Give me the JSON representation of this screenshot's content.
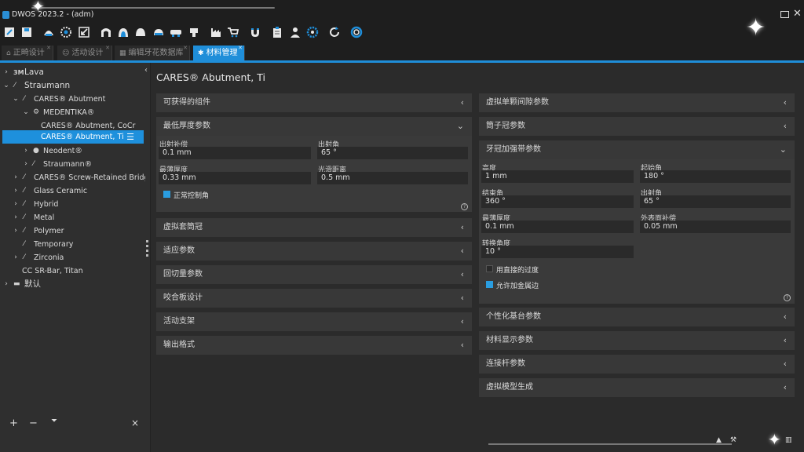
{
  "window": {
    "title": "DWOS 2023.2 - (adm)"
  },
  "toolbar": {
    "icons": [
      "edit-icon",
      "save-icon",
      "scan-icon",
      "gear-sphere-icon",
      "import-icon",
      "arch-upper-icon",
      "arch-lower-icon",
      "dome-icon",
      "crown-icon",
      "bridge-icon",
      "tooth-icon",
      "factory-icon",
      "cart-icon",
      "magnet-icon",
      "clipboard-icon",
      "person-icon",
      "settings-icon",
      "refresh-icon",
      "lifebuoy-icon"
    ]
  },
  "tabs": [
    {
      "label": "正畸设计",
      "active": false
    },
    {
      "label": "活动设计",
      "active": false
    },
    {
      "label": "编辑牙花数据库",
      "active": false
    },
    {
      "label": "材料管理",
      "active": true
    }
  ],
  "tree": [
    {
      "label": "Lava",
      "level": 0,
      "expanded": false,
      "icon": "3m-icon"
    },
    {
      "label": "Straumann",
      "level": 0,
      "expanded": true,
      "icon": "brand-icon"
    },
    {
      "label": "CARES® Abutment",
      "level": 1,
      "expanded": true,
      "icon": "brand-icon"
    },
    {
      "label": "MEDENTIKA®",
      "level": 2,
      "expanded": true,
      "icon": "gear-icon"
    },
    {
      "label": "CARES® Abutment, CoCr",
      "level": 3
    },
    {
      "label": "CARES® Abutment, Ti",
      "level": 3,
      "selected": true
    },
    {
      "label": "Neodent®",
      "level": 2,
      "expanded": false,
      "icon": "circle-icon"
    },
    {
      "label": "Straumann®",
      "level": 2,
      "expanded": false,
      "icon": "brand-icon"
    },
    {
      "label": "CARES® Screw-Retained Bridg...",
      "level": 1,
      "expanded": false,
      "icon": "brand-icon"
    },
    {
      "label": "Glass Ceramic",
      "level": 1,
      "expanded": false,
      "icon": "brand-icon"
    },
    {
      "label": "Hybrid",
      "level": 1,
      "expanded": false,
      "icon": "brand-icon"
    },
    {
      "label": "Metal",
      "level": 1,
      "expanded": false,
      "icon": "brand-icon"
    },
    {
      "label": "Polymer",
      "level": 1,
      "expanded": false,
      "icon": "brand-icon"
    },
    {
      "label": "Temporary",
      "level": 1,
      "icon": "brand-icon"
    },
    {
      "label": "Zirconia",
      "level": 1,
      "expanded": false,
      "icon": "brand-icon"
    },
    {
      "label": "CC SR-Bar, Titan",
      "level": 1
    },
    {
      "label": "默认",
      "level": 0,
      "expanded": false,
      "icon": "folder-icon"
    }
  ],
  "sidebar_bottom": {
    "add": "+",
    "remove": "−",
    "filter": "filter-icon",
    "clear": "×"
  },
  "main": {
    "title": "CARES® Abutment, Ti",
    "left_sections": [
      {
        "id": "available",
        "title": "可获得的组件",
        "expanded": false
      },
      {
        "id": "min_thickness",
        "title": "最低厚度参数",
        "expanded": true
      },
      {
        "id": "virtual_coping",
        "title": "虚拟套筒冠",
        "expanded": false
      },
      {
        "id": "fit",
        "title": "适应参数",
        "expanded": false
      },
      {
        "id": "cutback",
        "title": "回切量参数",
        "expanded": false
      },
      {
        "id": "occlusal",
        "title": "咬合板设计",
        "expanded": false
      },
      {
        "id": "active_support",
        "title": "活动支架",
        "expanded": false
      },
      {
        "id": "output",
        "title": "输出格式",
        "expanded": false
      }
    ],
    "min_thickness": {
      "fields": [
        {
          "label": "出射补偿",
          "value": "0.1 mm"
        },
        {
          "label": "出射角",
          "value": "65 °"
        },
        {
          "label": "最薄厚度",
          "value": "0.33 mm"
        },
        {
          "label": "光滑距离",
          "value": "0.5 mm"
        }
      ],
      "checkbox": {
        "label": "正常控制角",
        "checked": true
      }
    },
    "right_sections": [
      {
        "id": "die_gap",
        "title": "虚拟单颗间隙参数",
        "expanded": false
      },
      {
        "id": "thimble",
        "title": "筒子冠参数",
        "expanded": false
      },
      {
        "id": "reinforce",
        "title": "牙冠加强带参数",
        "expanded": true
      },
      {
        "id": "custom_base",
        "title": "个性化基台参数",
        "expanded": false
      },
      {
        "id": "display",
        "title": "材料显示参数",
        "expanded": false
      },
      {
        "id": "connector",
        "title": "连接杆参数",
        "expanded": false
      },
      {
        "id": "model",
        "title": "虚拟模型生成",
        "expanded": false
      }
    ],
    "reinforce": {
      "fields": [
        {
          "label": "高度",
          "value": "1 mm"
        },
        {
          "label": "起始角",
          "value": "180 °"
        },
        {
          "label": "结束角",
          "value": "360 °"
        },
        {
          "label": "出射角",
          "value": "65 °"
        },
        {
          "label": "最薄厚度",
          "value": "0.1 mm"
        },
        {
          "label": "外表面补偿",
          "value": "0.05 mm"
        },
        {
          "label": "转换角度",
          "value": "10 °"
        }
      ],
      "checkboxes": [
        {
          "label": "用直接的过度",
          "checked": false
        },
        {
          "label": "允许加金属边",
          "checked": true
        }
      ]
    }
  },
  "colors": {
    "accent": "#1f8ed9",
    "panel": "#383838",
    "input": "#2a2a2a"
  }
}
